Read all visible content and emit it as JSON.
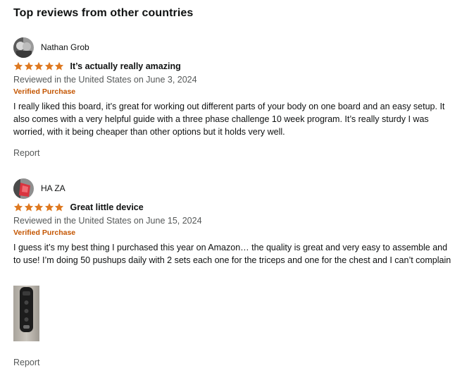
{
  "section": {
    "title": "Top reviews from other countries"
  },
  "reviews": [
    {
      "author": "Nathan Grob",
      "avatar_icon": "avatar-photo",
      "rating": 5,
      "title": "It’s actually really amazing",
      "date_line": "Reviewed in the United States on June 3, 2024",
      "verified": "Verified Purchase",
      "body": "I really liked this board, it’s great for working out different parts of your body on one board and an easy setup. It also comes with a very helpful guide with a three phase challenge 10 week program. It’s really sturdy I was worried, with it being cheaper than other options but it holds very well.",
      "report": "Report"
    },
    {
      "author": "HA ZA",
      "avatar_icon": "avatar-photo",
      "rating": 5,
      "title": "Great little device",
      "date_line": "Reviewed in the United States on June 15, 2024",
      "verified": "Verified Purchase",
      "body": "I guess it’s my best thing I purchased this year on Amazon… the quality is great and very easy to assemble and to use! I’m doing 50 pushups daily with 2 sets each one for the triceps and one for the chest and I can’t complain",
      "report": "Report"
    }
  ],
  "colors": {
    "star": "#de7921",
    "verified": "#c45500",
    "muted": "#565959",
    "text": "#0f1111"
  }
}
